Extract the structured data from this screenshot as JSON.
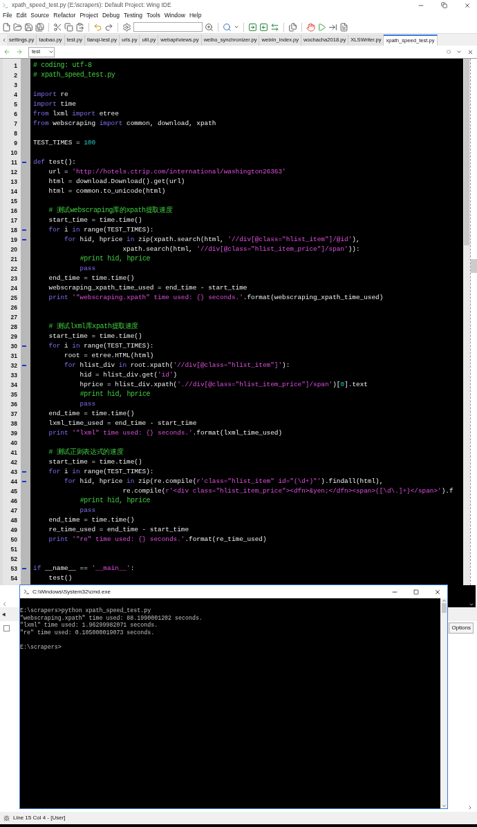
{
  "window": {
    "title": "xpath_speed_test.py (E:\\scrapers): Default Project: Wing IDE"
  },
  "menu": [
    "File",
    "Edit",
    "Source",
    "Refactor",
    "Project",
    "Debug",
    "Testing",
    "Tools",
    "Window",
    "Help"
  ],
  "tabs": [
    {
      "label": "settings.py",
      "selected": false
    },
    {
      "label": "taobao.py",
      "selected": false
    },
    {
      "label": "test.py",
      "selected": false
    },
    {
      "label": "tianqi-test.py",
      "selected": false
    },
    {
      "label": "urls.py",
      "selected": false
    },
    {
      "label": "util.py",
      "selected": false
    },
    {
      "label": "webapi\\views.py",
      "selected": false
    },
    {
      "label": "weibo_synchronizer.py",
      "selected": false
    },
    {
      "label": "weixin_index.py",
      "selected": false
    },
    {
      "label": "wochacha2018.py",
      "selected": false
    },
    {
      "label": "XLSWriter.py",
      "selected": false
    },
    {
      "label": "xpath_speed_test.py",
      "selected": true
    }
  ],
  "navigator": {
    "scope": "test"
  },
  "editor": {
    "lines": [
      {
        "number": "1",
        "fold": false,
        "tokens": [
          {
            "kind": "comment",
            "text": "# coding: utf-8"
          }
        ]
      },
      {
        "number": "2",
        "fold": false,
        "tokens": [
          {
            "kind": "comment",
            "text": "# xpath_speed_test.py"
          }
        ]
      },
      {
        "number": "3",
        "fold": false
      },
      {
        "number": "4",
        "fold": false,
        "tokens": [
          {
            "kind": "keyword",
            "text": "import"
          },
          {
            "kind": "plain",
            "text": " re"
          }
        ]
      },
      {
        "number": "5",
        "fold": false,
        "tokens": [
          {
            "kind": "keyword",
            "text": "import"
          },
          {
            "kind": "plain",
            "text": " time"
          }
        ]
      },
      {
        "number": "6",
        "fold": false,
        "tokens": [
          {
            "kind": "keyword",
            "text": "from"
          },
          {
            "kind": "plain",
            "text": " lxml "
          },
          {
            "kind": "keyword",
            "text": "import"
          },
          {
            "kind": "plain",
            "text": " etree"
          }
        ]
      },
      {
        "number": "7",
        "fold": false,
        "tokens": [
          {
            "kind": "keyword",
            "text": "from"
          },
          {
            "kind": "plain",
            "text": " webscraping "
          },
          {
            "kind": "keyword",
            "text": "import"
          },
          {
            "kind": "plain",
            "text": " common, download, xpath"
          }
        ]
      },
      {
        "number": "8",
        "fold": false
      },
      {
        "number": "9",
        "fold": false,
        "tokens": [
          {
            "kind": "plain",
            "text": "TEST_TIMES = "
          },
          {
            "kind": "number",
            "text": "100"
          }
        ]
      },
      {
        "number": "10",
        "fold": false
      },
      {
        "number": "11",
        "fold": true,
        "tokens": [
          {
            "kind": "keyword",
            "text": "def"
          },
          {
            "kind": "plain",
            "text": " test():"
          }
        ]
      },
      {
        "number": "12",
        "fold": false,
        "tokens": [
          {
            "kind": "plain",
            "text": "    url = "
          },
          {
            "kind": "string",
            "text": "'http://hotels.ctrip.com/international/washington26363'"
          }
        ]
      },
      {
        "number": "13",
        "fold": false,
        "tokens": [
          {
            "kind": "plain",
            "text": "    html = download.Download().get(url)"
          }
        ]
      },
      {
        "number": "14",
        "fold": false,
        "tokens": [
          {
            "kind": "plain",
            "text": "    html = common.to_unicode(html)"
          }
        ]
      },
      {
        "number": "15",
        "fold": false
      },
      {
        "number": "16",
        "fold": false,
        "tokens": [
          {
            "kind": "comment",
            "text": "    # 测试webscraping库的xpath提取速度"
          }
        ]
      },
      {
        "number": "17",
        "fold": false,
        "tokens": [
          {
            "kind": "plain",
            "text": "    start_time = time.time()"
          }
        ]
      },
      {
        "number": "18",
        "fold": true,
        "tokens": [
          {
            "kind": "keyword",
            "text": "    for"
          },
          {
            "kind": "plain",
            "text": " i "
          },
          {
            "kind": "keyword",
            "text": "in"
          },
          {
            "kind": "plain",
            "text": " range(TEST_TIMES):"
          }
        ]
      },
      {
        "number": "19",
        "fold": true,
        "tokens": [
          {
            "kind": "keyword",
            "text": "        for"
          },
          {
            "kind": "plain",
            "text": " hid, hprice "
          },
          {
            "kind": "keyword",
            "text": "in"
          },
          {
            "kind": "plain",
            "text": " zip(xpath.search(html, "
          },
          {
            "kind": "string",
            "text": "'//div[@class=\"hlist_item\"]/@id'"
          },
          {
            "kind": "plain",
            "text": "),"
          }
        ]
      },
      {
        "number": "20",
        "fold": false,
        "tokens": [
          {
            "kind": "plain",
            "text": "                       xpath.search(html, "
          },
          {
            "kind": "string",
            "text": "'//div[@class=\"hlist_item_price\"]/span'"
          },
          {
            "kind": "plain",
            "text": ")):"
          }
        ]
      },
      {
        "number": "21",
        "fold": false,
        "tokens": [
          {
            "kind": "comment",
            "text": "            #print hid, hprice"
          }
        ]
      },
      {
        "number": "22",
        "fold": false,
        "tokens": [
          {
            "kind": "keyword",
            "text": "            pass"
          }
        ]
      },
      {
        "number": "23",
        "fold": false,
        "tokens": [
          {
            "kind": "plain",
            "text": "    end_time = time.time()"
          }
        ]
      },
      {
        "number": "24",
        "fold": false,
        "tokens": [
          {
            "kind": "plain",
            "text": "    webscraping_xpath_time_used = end_time - start_time"
          }
        ]
      },
      {
        "number": "25",
        "fold": false,
        "tokens": [
          {
            "kind": "keyword",
            "text": "    print"
          },
          {
            "kind": "string",
            "text": " '\"webscraping.xpath\" time used: {} seconds.'"
          },
          {
            "kind": "plain",
            "text": ".format(webscraping_xpath_time_used)"
          }
        ]
      },
      {
        "number": "26",
        "fold": false
      },
      {
        "number": "27",
        "fold": false
      },
      {
        "number": "28",
        "fold": false,
        "tokens": [
          {
            "kind": "comment",
            "text": "    # 测试lxml库xpath提取速度"
          }
        ]
      },
      {
        "number": "29",
        "fold": false,
        "tokens": [
          {
            "kind": "plain",
            "text": "    start_time = time.time()"
          }
        ]
      },
      {
        "number": "30",
        "fold": true,
        "tokens": [
          {
            "kind": "keyword",
            "text": "    for"
          },
          {
            "kind": "plain",
            "text": " i "
          },
          {
            "kind": "keyword",
            "text": "in"
          },
          {
            "kind": "plain",
            "text": " range(TEST_TIMES):"
          }
        ]
      },
      {
        "number": "31",
        "fold": false,
        "tokens": [
          {
            "kind": "plain",
            "text": "        root = etree.HTML(html)"
          }
        ]
      },
      {
        "number": "32",
        "fold": true,
        "tokens": [
          {
            "kind": "keyword",
            "text": "        for"
          },
          {
            "kind": "plain",
            "text": " hlist_div "
          },
          {
            "kind": "keyword",
            "text": "in"
          },
          {
            "kind": "plain",
            "text": " root.xpath("
          },
          {
            "kind": "string",
            "text": "'//div[@class=\"hlist_item\"]'"
          },
          {
            "kind": "plain",
            "text": "):"
          }
        ]
      },
      {
        "number": "33",
        "fold": false,
        "tokens": [
          {
            "kind": "plain",
            "text": "            hid = hlist_div.get("
          },
          {
            "kind": "string",
            "text": "'id'"
          },
          {
            "kind": "plain",
            "text": ")"
          }
        ]
      },
      {
        "number": "34",
        "fold": false,
        "tokens": [
          {
            "kind": "plain",
            "text": "            hprice = hlist_div.xpath("
          },
          {
            "kind": "string",
            "text": "'.//div[@class=\"hlist_item_price\"]/span'"
          },
          {
            "kind": "plain",
            "text": ")["
          },
          {
            "kind": "number",
            "text": "0"
          },
          {
            "kind": "plain",
            "text": "].text"
          }
        ]
      },
      {
        "number": "35",
        "fold": false,
        "tokens": [
          {
            "kind": "comment",
            "text": "            #print hid, hprice"
          }
        ]
      },
      {
        "number": "36",
        "fold": false,
        "tokens": [
          {
            "kind": "keyword",
            "text": "            pass"
          }
        ]
      },
      {
        "number": "37",
        "fold": false,
        "tokens": [
          {
            "kind": "plain",
            "text": "    end_time = time.time()"
          }
        ]
      },
      {
        "number": "38",
        "fold": false,
        "tokens": [
          {
            "kind": "plain",
            "text": "    lxml_time_used = end_time - start_time"
          }
        ]
      },
      {
        "number": "39",
        "fold": false,
        "tokens": [
          {
            "kind": "keyword",
            "text": "    print"
          },
          {
            "kind": "string",
            "text": " '\"lxml\" time used: {} seconds.'"
          },
          {
            "kind": "plain",
            "text": ".format(lxml_time_used)"
          }
        ]
      },
      {
        "number": "40",
        "fold": false
      },
      {
        "number": "41",
        "fold": false,
        "tokens": [
          {
            "kind": "comment",
            "text": "    # 测试正则表达式的速度"
          }
        ]
      },
      {
        "number": "42",
        "fold": false,
        "tokens": [
          {
            "kind": "plain",
            "text": "    start_time = time.time()"
          }
        ]
      },
      {
        "number": "43",
        "fold": true,
        "tokens": [
          {
            "kind": "keyword",
            "text": "    for"
          },
          {
            "kind": "plain",
            "text": " i "
          },
          {
            "kind": "keyword",
            "text": "in"
          },
          {
            "kind": "plain",
            "text": " range(TEST_TIMES):"
          }
        ]
      },
      {
        "number": "44",
        "fold": true,
        "tokens": [
          {
            "kind": "keyword",
            "text": "        for"
          },
          {
            "kind": "plain",
            "text": " hid, hprice "
          },
          {
            "kind": "keyword",
            "text": "in"
          },
          {
            "kind": "plain",
            "text": " zip(re.compile("
          },
          {
            "kind": "string",
            "text": "r'class=\"hlist_item\" id=\"(\\d+)\"'"
          },
          {
            "kind": "plain",
            "text": ").findall(html),"
          }
        ]
      },
      {
        "number": "45",
        "fold": false,
        "tokens": [
          {
            "kind": "plain",
            "text": "                       re.compile("
          },
          {
            "kind": "string",
            "text": "r'<div class=\"hlist_item_price\"><dfn>&yen;</dfn><span>([\\d\\.]+)</span>'"
          },
          {
            "kind": "plain",
            "text": ").f"
          }
        ]
      },
      {
        "number": "46",
        "fold": false,
        "tokens": [
          {
            "kind": "comment",
            "text": "            #print hid, hprice"
          }
        ]
      },
      {
        "number": "47",
        "fold": false,
        "tokens": [
          {
            "kind": "keyword",
            "text": "            pass"
          }
        ]
      },
      {
        "number": "48",
        "fold": false,
        "tokens": [
          {
            "kind": "plain",
            "text": "    end_time = time.time()"
          }
        ]
      },
      {
        "number": "49",
        "fold": false,
        "tokens": [
          {
            "kind": "plain",
            "text": "    re_time_used = end_time - start_time"
          }
        ]
      },
      {
        "number": "50",
        "fold": false,
        "tokens": [
          {
            "kind": "keyword",
            "text": "    print"
          },
          {
            "kind": "string",
            "text": " '\"re\" time used: {} seconds.'"
          },
          {
            "kind": "plain",
            "text": ".format(re_time_used)"
          }
        ]
      },
      {
        "number": "51",
        "fold": false
      },
      {
        "number": "52",
        "fold": false
      },
      {
        "number": "53",
        "fold": true,
        "tokens": [
          {
            "kind": "keyword",
            "text": "if"
          },
          {
            "kind": "plain",
            "text": " __name__ == "
          },
          {
            "kind": "string",
            "text": "'__main__'"
          },
          {
            "kind": "plain",
            "text": ":"
          }
        ]
      },
      {
        "number": "54",
        "fold": false,
        "tokens": [
          {
            "kind": "plain",
            "text": "    test()"
          }
        ]
      }
    ]
  },
  "bottom_panel": {
    "checkbox": {
      "checked": false
    },
    "options_button": "Options"
  },
  "console": {
    "title": "C:\\Windows\\System32\\cmd.exe",
    "lines": [
      "E:\\scrapers>python xpath_speed_test.py",
      "\"webscraping.xpath\" time used: 88.1990001202 seconds.",
      "\"lxml\" time used: 1.96299982071 seconds.",
      "\"re\" time used: 0.105000019073 seconds."
    ],
    "prompt": "E:\\scrapers>"
  },
  "status_bar": {
    "text": "Line 15 Col 4 - [User]"
  }
}
